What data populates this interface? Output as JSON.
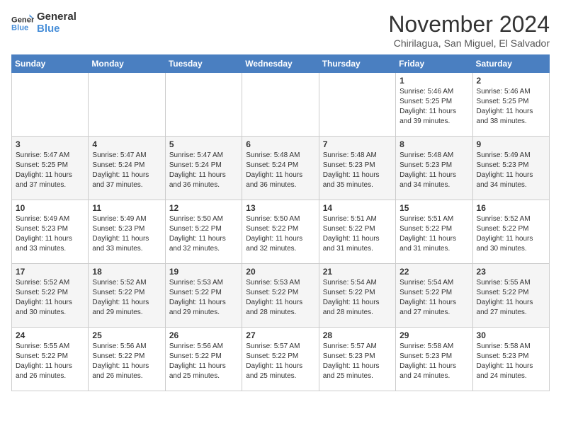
{
  "header": {
    "logo": {
      "line1": "General",
      "line2": "Blue"
    },
    "month": "November 2024",
    "location": "Chirilagua, San Miguel, El Salvador"
  },
  "weekdays": [
    "Sunday",
    "Monday",
    "Tuesday",
    "Wednesday",
    "Thursday",
    "Friday",
    "Saturday"
  ],
  "weeks": [
    [
      {
        "day": "",
        "info": ""
      },
      {
        "day": "",
        "info": ""
      },
      {
        "day": "",
        "info": ""
      },
      {
        "day": "",
        "info": ""
      },
      {
        "day": "",
        "info": ""
      },
      {
        "day": "1",
        "info": "Sunrise: 5:46 AM\nSunset: 5:25 PM\nDaylight: 11 hours\nand 39 minutes."
      },
      {
        "day": "2",
        "info": "Sunrise: 5:46 AM\nSunset: 5:25 PM\nDaylight: 11 hours\nand 38 minutes."
      }
    ],
    [
      {
        "day": "3",
        "info": "Sunrise: 5:47 AM\nSunset: 5:25 PM\nDaylight: 11 hours\nand 37 minutes."
      },
      {
        "day": "4",
        "info": "Sunrise: 5:47 AM\nSunset: 5:24 PM\nDaylight: 11 hours\nand 37 minutes."
      },
      {
        "day": "5",
        "info": "Sunrise: 5:47 AM\nSunset: 5:24 PM\nDaylight: 11 hours\nand 36 minutes."
      },
      {
        "day": "6",
        "info": "Sunrise: 5:48 AM\nSunset: 5:24 PM\nDaylight: 11 hours\nand 36 minutes."
      },
      {
        "day": "7",
        "info": "Sunrise: 5:48 AM\nSunset: 5:23 PM\nDaylight: 11 hours\nand 35 minutes."
      },
      {
        "day": "8",
        "info": "Sunrise: 5:48 AM\nSunset: 5:23 PM\nDaylight: 11 hours\nand 34 minutes."
      },
      {
        "day": "9",
        "info": "Sunrise: 5:49 AM\nSunset: 5:23 PM\nDaylight: 11 hours\nand 34 minutes."
      }
    ],
    [
      {
        "day": "10",
        "info": "Sunrise: 5:49 AM\nSunset: 5:23 PM\nDaylight: 11 hours\nand 33 minutes."
      },
      {
        "day": "11",
        "info": "Sunrise: 5:49 AM\nSunset: 5:23 PM\nDaylight: 11 hours\nand 33 minutes."
      },
      {
        "day": "12",
        "info": "Sunrise: 5:50 AM\nSunset: 5:22 PM\nDaylight: 11 hours\nand 32 minutes."
      },
      {
        "day": "13",
        "info": "Sunrise: 5:50 AM\nSunset: 5:22 PM\nDaylight: 11 hours\nand 32 minutes."
      },
      {
        "day": "14",
        "info": "Sunrise: 5:51 AM\nSunset: 5:22 PM\nDaylight: 11 hours\nand 31 minutes."
      },
      {
        "day": "15",
        "info": "Sunrise: 5:51 AM\nSunset: 5:22 PM\nDaylight: 11 hours\nand 31 minutes."
      },
      {
        "day": "16",
        "info": "Sunrise: 5:52 AM\nSunset: 5:22 PM\nDaylight: 11 hours\nand 30 minutes."
      }
    ],
    [
      {
        "day": "17",
        "info": "Sunrise: 5:52 AM\nSunset: 5:22 PM\nDaylight: 11 hours\nand 30 minutes."
      },
      {
        "day": "18",
        "info": "Sunrise: 5:52 AM\nSunset: 5:22 PM\nDaylight: 11 hours\nand 29 minutes."
      },
      {
        "day": "19",
        "info": "Sunrise: 5:53 AM\nSunset: 5:22 PM\nDaylight: 11 hours\nand 29 minutes."
      },
      {
        "day": "20",
        "info": "Sunrise: 5:53 AM\nSunset: 5:22 PM\nDaylight: 11 hours\nand 28 minutes."
      },
      {
        "day": "21",
        "info": "Sunrise: 5:54 AM\nSunset: 5:22 PM\nDaylight: 11 hours\nand 28 minutes."
      },
      {
        "day": "22",
        "info": "Sunrise: 5:54 AM\nSunset: 5:22 PM\nDaylight: 11 hours\nand 27 minutes."
      },
      {
        "day": "23",
        "info": "Sunrise: 5:55 AM\nSunset: 5:22 PM\nDaylight: 11 hours\nand 27 minutes."
      }
    ],
    [
      {
        "day": "24",
        "info": "Sunrise: 5:55 AM\nSunset: 5:22 PM\nDaylight: 11 hours\nand 26 minutes."
      },
      {
        "day": "25",
        "info": "Sunrise: 5:56 AM\nSunset: 5:22 PM\nDaylight: 11 hours\nand 26 minutes."
      },
      {
        "day": "26",
        "info": "Sunrise: 5:56 AM\nSunset: 5:22 PM\nDaylight: 11 hours\nand 25 minutes."
      },
      {
        "day": "27",
        "info": "Sunrise: 5:57 AM\nSunset: 5:22 PM\nDaylight: 11 hours\nand 25 minutes."
      },
      {
        "day": "28",
        "info": "Sunrise: 5:57 AM\nSunset: 5:23 PM\nDaylight: 11 hours\nand 25 minutes."
      },
      {
        "day": "29",
        "info": "Sunrise: 5:58 AM\nSunset: 5:23 PM\nDaylight: 11 hours\nand 24 minutes."
      },
      {
        "day": "30",
        "info": "Sunrise: 5:58 AM\nSunset: 5:23 PM\nDaylight: 11 hours\nand 24 minutes."
      }
    ]
  ]
}
